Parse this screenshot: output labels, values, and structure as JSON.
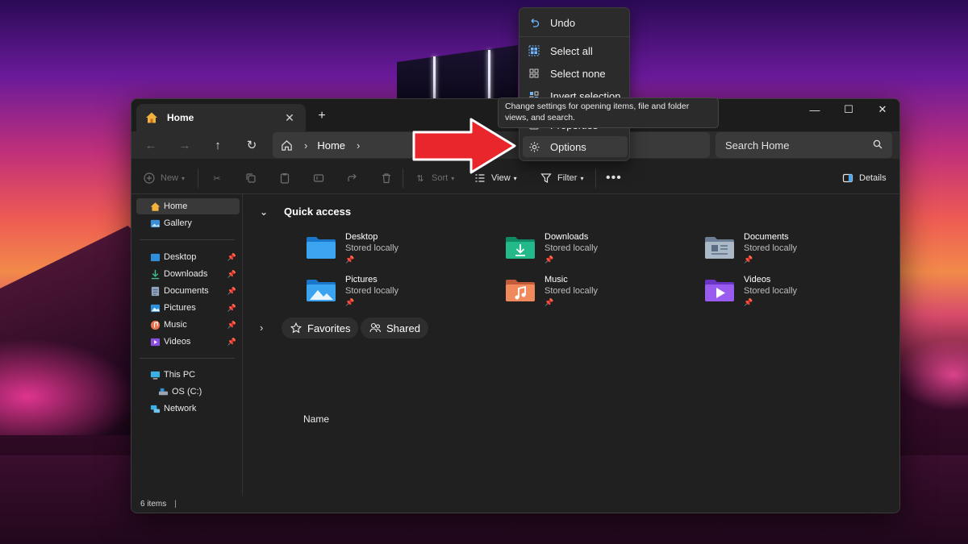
{
  "window": {
    "tab_title": "Home",
    "address_home": "Home",
    "search_placeholder": "Search Home"
  },
  "toolbar": {
    "new_label": "New",
    "sort_label": "Sort",
    "view_label": "View",
    "filter_label": "Filter",
    "details_label": "Details"
  },
  "sidebar": {
    "items": [
      {
        "label": "Home",
        "icon": "home-icon"
      },
      {
        "label": "Gallery",
        "icon": "gallery-icon"
      },
      {
        "label": "Desktop",
        "icon": "desktop-icon"
      },
      {
        "label": "Downloads",
        "icon": "downloads-icon"
      },
      {
        "label": "Documents",
        "icon": "documents-icon"
      },
      {
        "label": "Pictures",
        "icon": "pictures-icon"
      },
      {
        "label": "Music",
        "icon": "music-icon"
      },
      {
        "label": "Videos",
        "icon": "videos-icon"
      },
      {
        "label": "This PC",
        "icon": "pc-icon"
      },
      {
        "label": "OS (C:)",
        "icon": "drive-icon"
      },
      {
        "label": "Network",
        "icon": "network-icon"
      }
    ]
  },
  "content": {
    "section_title": "Quick access",
    "quick_access": [
      {
        "name": "Desktop",
        "status": "Stored locally"
      },
      {
        "name": "Downloads",
        "status": "Stored locally"
      },
      {
        "name": "Documents",
        "status": "Stored locally"
      },
      {
        "name": "Pictures",
        "status": "Stored locally"
      },
      {
        "name": "Music",
        "status": "Stored locally"
      },
      {
        "name": "Videos",
        "status": "Stored locally"
      }
    ],
    "chips": {
      "favorites": "Favorites",
      "shared": "Shared"
    },
    "column_name": "Name"
  },
  "status": {
    "item_count": "6 items"
  },
  "context_menu": {
    "items": [
      "Undo",
      "Select all",
      "Select none",
      "Invert selection",
      "Properties",
      "Options"
    ]
  },
  "tooltip": {
    "text": "Change settings for opening items, file and folder views, and search."
  },
  "colors": {
    "accent_arrow": "#e8262b",
    "window_bg": "#202020"
  }
}
